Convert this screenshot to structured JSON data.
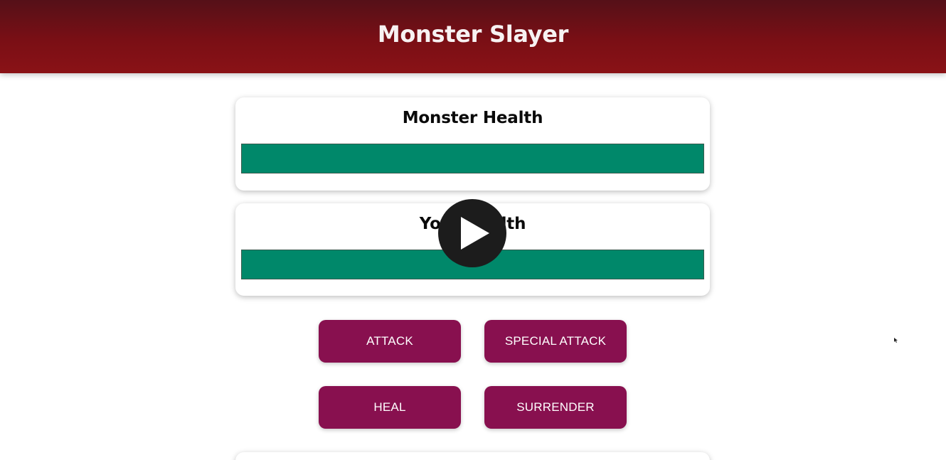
{
  "header": {
    "title": "Monster Slayer"
  },
  "monster": {
    "heading": "Monster Health",
    "health_percent": 100
  },
  "player": {
    "heading": "Your Health",
    "health_percent": 100
  },
  "controls": {
    "attack_label": "ATTACK",
    "special_attack_label": "SPECIAL ATTACK",
    "heal_label": "HEAL",
    "surrender_label": "SURRENDER"
  },
  "video_overlay": {
    "icon": "play-icon"
  },
  "colors": {
    "header_gradient_top": "#551018",
    "header_gradient_bottom": "#8a1216",
    "health_fill": "#00886a",
    "button_bg": "#88104f"
  }
}
